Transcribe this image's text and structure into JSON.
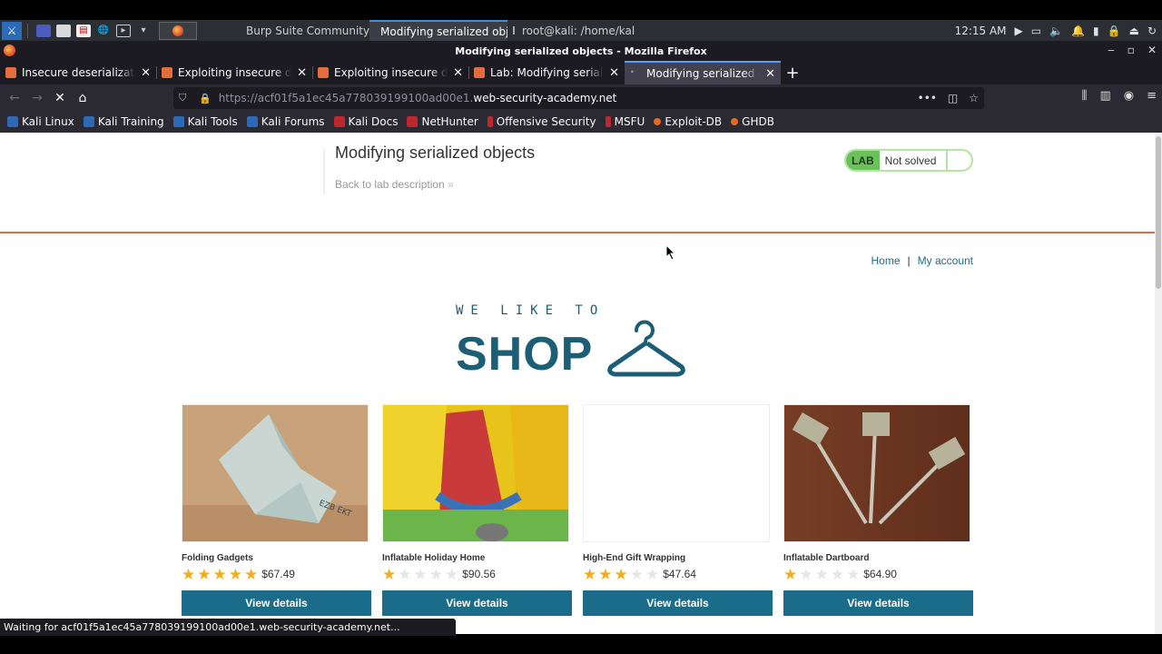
{
  "panel": {
    "clock": "12:15 AM",
    "tasks": [
      {
        "label": "Burp Suite Community E..."
      },
      {
        "label": "Modifying serialized obj..."
      },
      {
        "label": "root@kali: /home/kali"
      }
    ]
  },
  "window": {
    "title": "Modifying serialized objects - Mozilla Firefox"
  },
  "tabs": [
    {
      "label": "Insecure deserialization |",
      "fav_color": "#e36d3b"
    },
    {
      "label": "Exploiting insecure deserial",
      "fav_color": "#e36d3b"
    },
    {
      "label": "Exploiting insecure deserial",
      "fav_color": "#e36d3b"
    },
    {
      "label": "Lab: Modifying serialized obj",
      "fav_color": "#e36d3b"
    },
    {
      "label": "Modifying serialized obje",
      "fav_color": "#7ab0e0"
    }
  ],
  "urlbar": {
    "prefix": "https://acf01f5a1ec45a778039199100ad00e1.",
    "domain": "web-security-academy.net"
  },
  "bookmarks": [
    {
      "label": "Kali Linux",
      "color": "#2d6ab5"
    },
    {
      "label": "Kali Training",
      "color": "#2d6ab5"
    },
    {
      "label": "Kali Tools",
      "color": "#2d6ab5"
    },
    {
      "label": "Kali Forums",
      "color": "#2d6ab5"
    },
    {
      "label": "Kali Docs",
      "color": "#c0262d"
    },
    {
      "label": "NetHunter",
      "color": "#c0262d"
    },
    {
      "label": "Offensive Security",
      "color": "#c0262d"
    },
    {
      "label": "MSFU",
      "color": "#c0262d"
    },
    {
      "label": "Exploit-DB",
      "color": "#e46b25"
    },
    {
      "label": "GHDB",
      "color": "#e46b25"
    }
  ],
  "lab": {
    "title": "Modifying serialized objects",
    "back_link": "Back to lab description",
    "badge": "LAB",
    "status": "Not solved"
  },
  "nav": {
    "home": "Home",
    "separator": "|",
    "account": "My account"
  },
  "logo": {
    "tagline": "WE LIKE TO",
    "word": "SHOP"
  },
  "products": [
    {
      "name": "Folding Gadgets",
      "rating": 5,
      "price": "$67.49",
      "button": "View details"
    },
    {
      "name": "Inflatable Holiday Home",
      "rating": 1,
      "price": "$90.56",
      "button": "View details"
    },
    {
      "name": "High-End Gift Wrapping",
      "rating": 3,
      "price": "$47.64",
      "button": "View details"
    },
    {
      "name": "Inflatable Dartboard",
      "rating": 1,
      "price": "$64.90",
      "button": "View details"
    }
  ],
  "statusbar": "Waiting for acf01f5a1ec45a778039199100ad00e1.web-security-academy.net..."
}
